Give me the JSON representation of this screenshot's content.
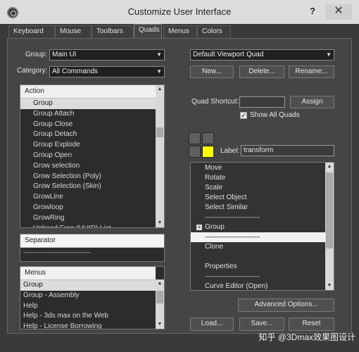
{
  "window": {
    "title": "Customize User Interface",
    "help": "?",
    "close": "✕"
  },
  "tabs": [
    "Keyboard",
    "Mouse",
    "Toolbars",
    "Quads",
    "Menus",
    "Colors"
  ],
  "left": {
    "group_label": "Group:",
    "group_value": "Main UI",
    "category_label": "Category:",
    "category_value": "All Commands",
    "action_header": "Action",
    "actions": [
      "Group",
      "Group Attach",
      "Group Close",
      "Group Detach",
      "Group Explode",
      "Group Open",
      "Grow selection",
      "Grow Selection (Poly)",
      "Grow Selection (Skin)",
      "GrowLine",
      "Growloop",
      "GrowRing",
      "Unhead Free (UUID) List"
    ],
    "separator_label": "Separator",
    "separator_line": "------------------------------------",
    "menus_header": "Menus",
    "menus": [
      "Group",
      "Group - Assembly",
      "Help",
      "Help - 3ds max on the Web",
      "Help - License Borrowing"
    ]
  },
  "right": {
    "quad_set": "Default Viewport Quad",
    "new_btn": "New...",
    "delete_btn": "Delete...",
    "rename_btn": "Rename...",
    "quad_shortcut_label": "Quad Shortcut:",
    "quad_shortcut_value": "",
    "assign_btn": "Assign",
    "show_all_quads": "Show All Quads",
    "show_all_checked": true,
    "label_label": "Label:",
    "label_value": "transform",
    "quad_items": [
      {
        "text": "Move",
        "kind": "item"
      },
      {
        "text": "Rotate",
        "kind": "item"
      },
      {
        "text": "Scale",
        "kind": "item"
      },
      {
        "text": "Select Object",
        "kind": "item"
      },
      {
        "text": "Select Similar",
        "kind": "item"
      },
      {
        "text": "------------------------------------",
        "kind": "sep"
      },
      {
        "text": "Group",
        "kind": "group"
      },
      {
        "text": "------------------------------------",
        "kind": "sepsel"
      },
      {
        "text": "Clone",
        "kind": "item"
      },
      {
        "text": "",
        "kind": "blank"
      },
      {
        "text": "Properties",
        "kind": "item"
      },
      {
        "text": "------------------------------------",
        "kind": "sep"
      },
      {
        "text": "Curve Editor (Open)",
        "kind": "item"
      }
    ],
    "advanced_btn": "Advanced Options...",
    "load_btn": "Load...",
    "save_btn": "Save...",
    "reset_btn": "Reset"
  },
  "colors": {
    "quad_active": "#ffff00",
    "quad_inactive": "#5f5f5f"
  },
  "watermark": "知乎 @3Dmax效果图设计"
}
